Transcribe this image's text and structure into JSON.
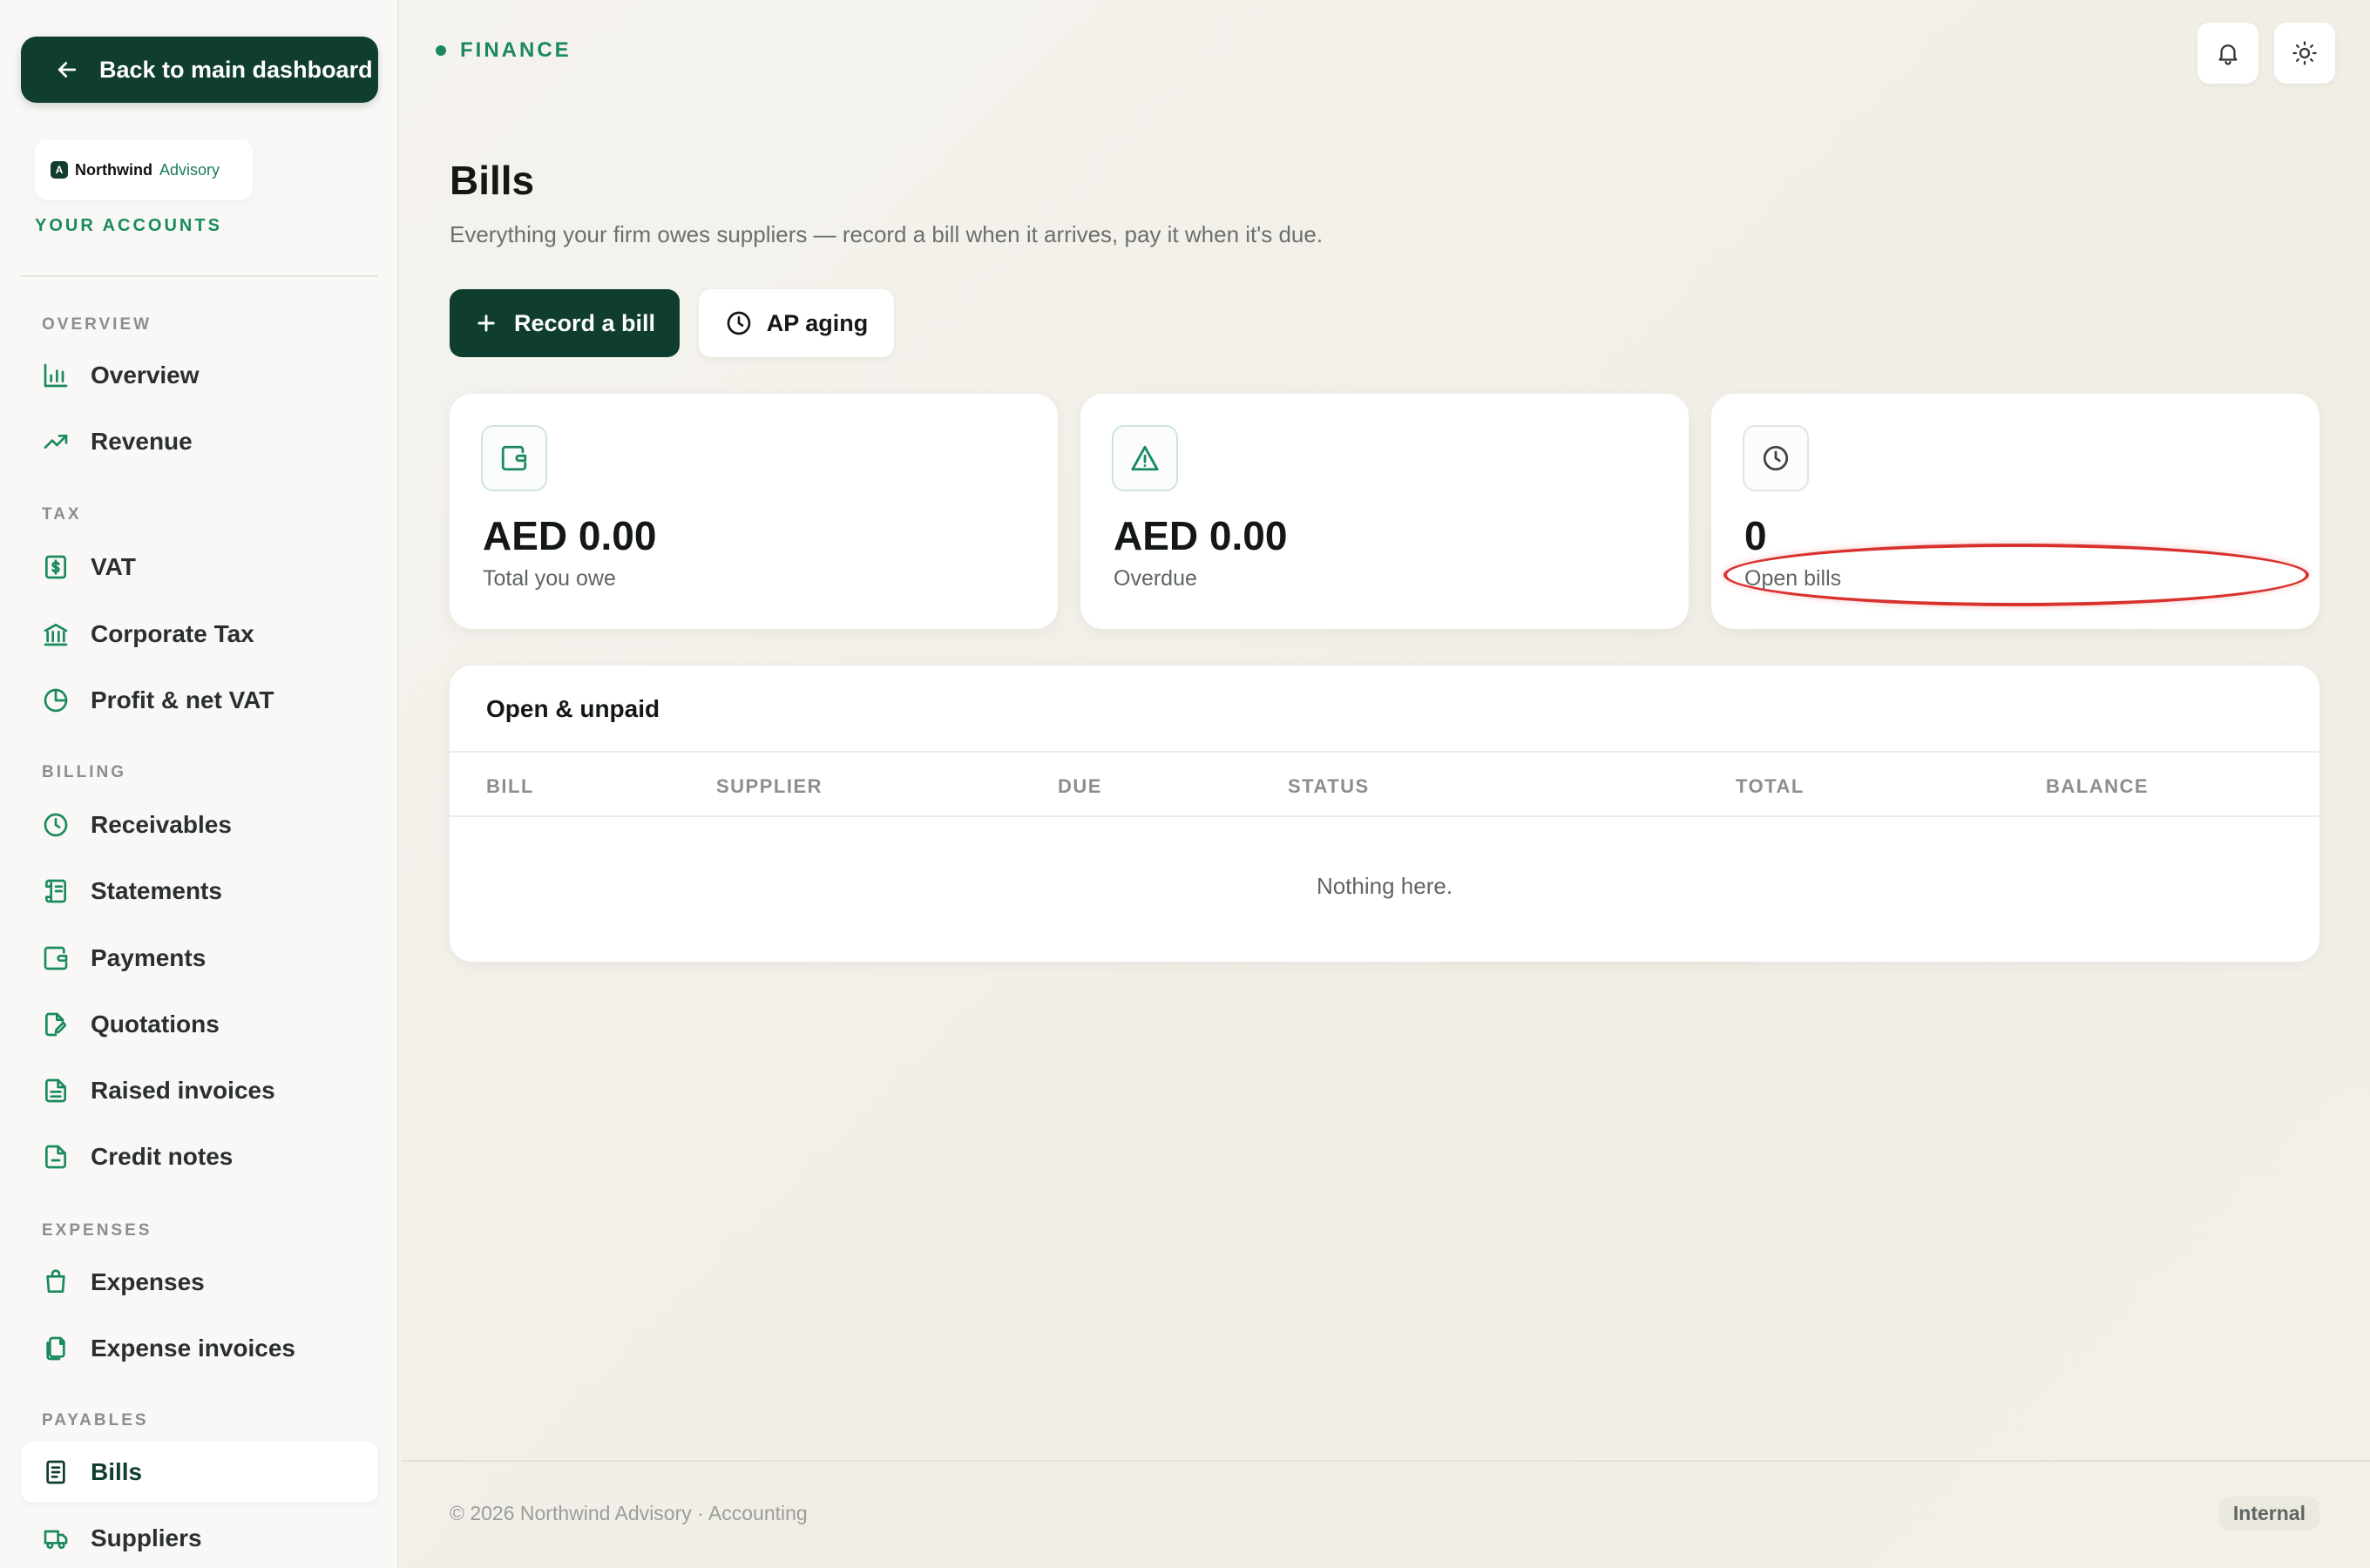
{
  "sidebar": {
    "back_label": "Back to main dashboard",
    "brand": {
      "mark": "A",
      "name": "Northwind",
      "sub": "Advisory"
    },
    "accounts_label": "YOUR ACCOUNTS",
    "sections": {
      "overview": "OVERVIEW",
      "tax": "TAX",
      "billing": "BILLING",
      "expenses": "EXPENSES",
      "payables": "PAYABLES"
    },
    "items": {
      "overview": "Overview",
      "revenue": "Revenue",
      "vat": "VAT",
      "corporate_tax": "Corporate Tax",
      "profit_vat": "Profit & net VAT",
      "receivables": "Receivables",
      "statements": "Statements",
      "payments": "Payments",
      "quotations": "Quotations",
      "raised_invoices": "Raised invoices",
      "credit_notes": "Credit notes",
      "expenses": "Expenses",
      "expense_invoices": "Expense invoices",
      "bills": "Bills",
      "suppliers": "Suppliers"
    },
    "active_item": "bills"
  },
  "header": {
    "breadcrumb": "FINANCE",
    "icons": [
      "bell-icon",
      "sun-icon"
    ]
  },
  "page": {
    "title": "Bills",
    "description": "Everything your firm owes suppliers — record a bill when it arrives, pay it when it's due.",
    "actions": {
      "record_bill": "Record a bill",
      "ap_aging": "AP aging"
    }
  },
  "stats": [
    {
      "icon": "wallet-icon",
      "value": "AED 0.00",
      "label": "Total you owe"
    },
    {
      "icon": "warning-icon",
      "value": "AED 0.00",
      "label": "Overdue"
    },
    {
      "icon": "clock-icon",
      "value": "0",
      "label": "Open bills"
    }
  ],
  "table": {
    "title": "Open & unpaid",
    "columns": [
      "BILL",
      "SUPPLIER",
      "DUE",
      "STATUS",
      "TOTAL",
      "BALANCE"
    ],
    "rows": [],
    "empty_text": "Nothing here."
  },
  "footer": {
    "text": "© 2026 Northwind Advisory · Accounting",
    "badge": "Internal"
  },
  "colors": {
    "primary": "#0f3d2e",
    "accent": "#1a8a5e",
    "annotation": "#d9322e",
    "background": "#f5f3ee"
  }
}
